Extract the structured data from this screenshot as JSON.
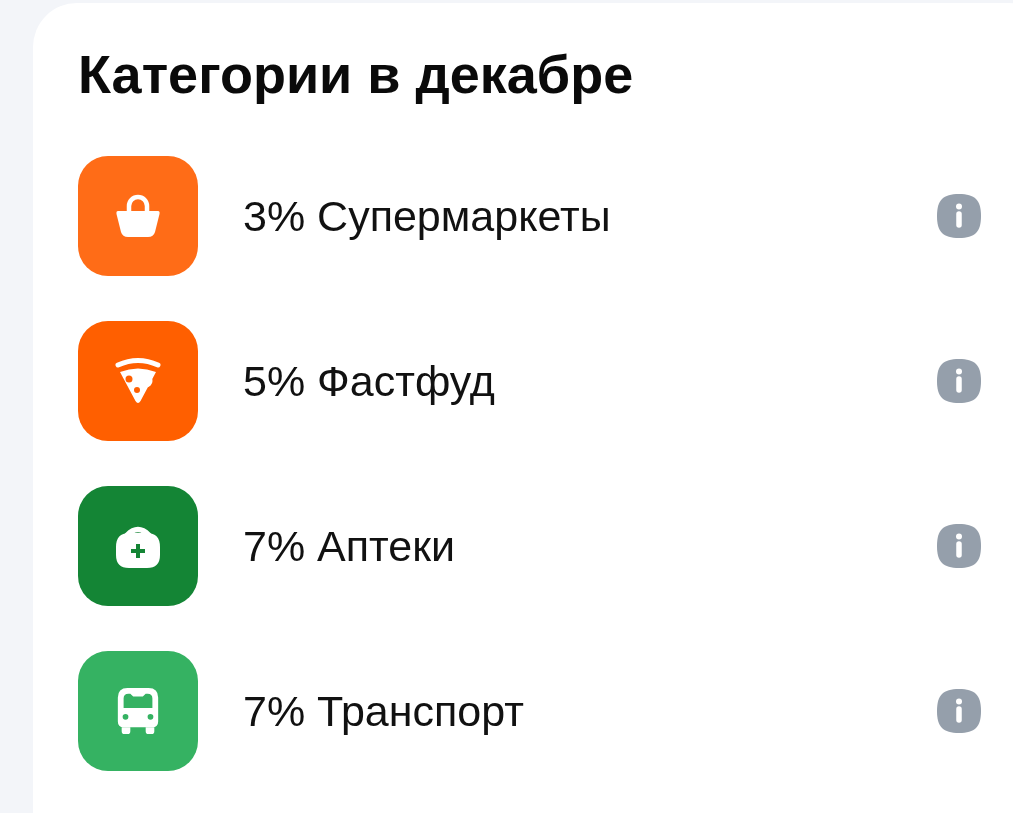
{
  "title": "Категории в декабре",
  "categories": [
    {
      "label": "3% Супермаркеты",
      "color": "#ff6c17"
    },
    {
      "label": "5% Фастфуд",
      "color": "#ff5f00"
    },
    {
      "label": "7% Аптеки",
      "color": "#148535"
    },
    {
      "label": "7% Транспорт",
      "color": "#35b262"
    }
  ]
}
